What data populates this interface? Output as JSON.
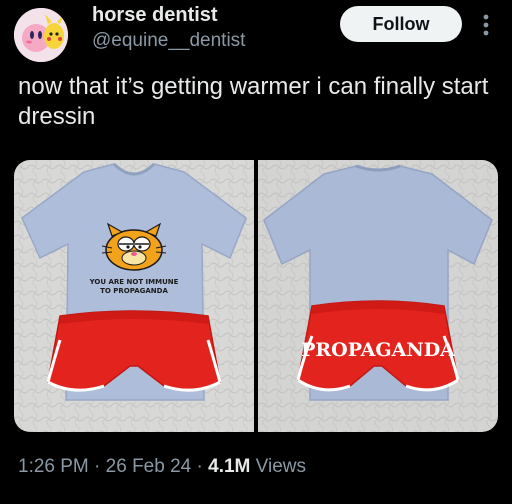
{
  "author": {
    "display_name": "horse dentist",
    "handle": "@equine__dentist"
  },
  "actions": {
    "follow_label": "Follow",
    "more_icon": "more-vertical-icon"
  },
  "post": {
    "text": "now that it’s getting warmer i can finally start dressin"
  },
  "media": {
    "photo_front": {
      "shirt_text_line1": "YOU ARE NOT IMMUNE",
      "shirt_text_line2": "TO PROPAGANDA"
    },
    "photo_back": {
      "shorts_text": "PROPAGANDA"
    }
  },
  "meta": {
    "time": "1:26 PM",
    "sep1": " · ",
    "date": "26 Feb 24",
    "sep2": " · ",
    "views_count": "4.1M",
    "views_label": " Views"
  },
  "colors": {
    "background": "#000000",
    "text_primary": "#e7e9ea",
    "text_secondary": "#8b98a5",
    "follow_bg": "#eff3f4",
    "shirt": "#a9b9d6",
    "shorts": "#e4251f",
    "bed": "#d9d9d9"
  }
}
